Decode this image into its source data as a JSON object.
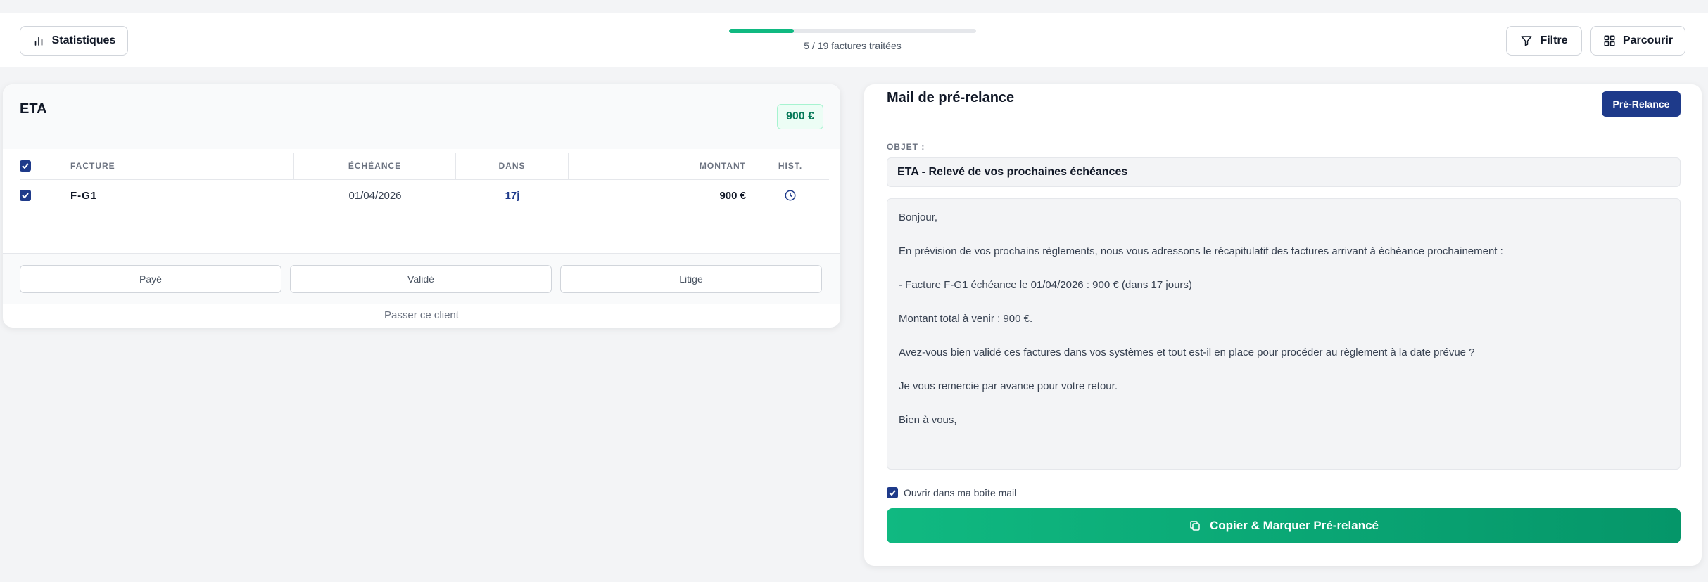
{
  "topbar": {
    "stats_label": "Statistiques",
    "progress": {
      "processed": 5,
      "total": 19,
      "fraction": 0.263,
      "label": "5 / 19 factures traitées"
    },
    "filter_label": "Filtre",
    "browse_label": "Parcourir"
  },
  "client": {
    "name": "ETA",
    "total": "900 €",
    "table": {
      "headers": {
        "invoice": "FACTURE",
        "due": "ÉCHÉANCE",
        "in": "DANS",
        "amount": "MONTANT",
        "hist": "HIST."
      },
      "rows": [
        {
          "invoice": "F-G1",
          "due": "01/04/2026",
          "in": "17j",
          "amount": "900 €",
          "checked": true
        }
      ]
    },
    "actions": {
      "paid": "Payé",
      "validated": "Validé",
      "dispute": "Litige"
    },
    "skip": "Passer ce client"
  },
  "mail": {
    "title": "Mail de pré-relance",
    "badge": "Pré-Relance",
    "subject_label": "OBJET :",
    "subject": "ETA - Relevé de vos prochaines échéances",
    "body": [
      "Bonjour,",
      "En prévision de vos prochains règlements, nous vous adressons le récapitulatif des factures arrivant à échéance prochainement :",
      "- Facture F-G1 échéance le 01/04/2026 : 900 € (dans 17 jours)",
      "Montant total à venir : 900 €.",
      "Avez-vous bien validé ces factures dans vos systèmes et tout est-il en place pour procéder au règlement à la date prévue ?",
      "Je vous remercie par avance pour votre retour.",
      "Bien à vous,"
    ],
    "open_in_mail_label": "Ouvrir dans ma boîte mail",
    "open_in_mail_checked": true,
    "cta_label": "Copier & Marquer Pré-relancé"
  },
  "colors": {
    "accent_green": "#10b981",
    "navy": "#1e3a8a",
    "background": "#f3f4f6"
  }
}
